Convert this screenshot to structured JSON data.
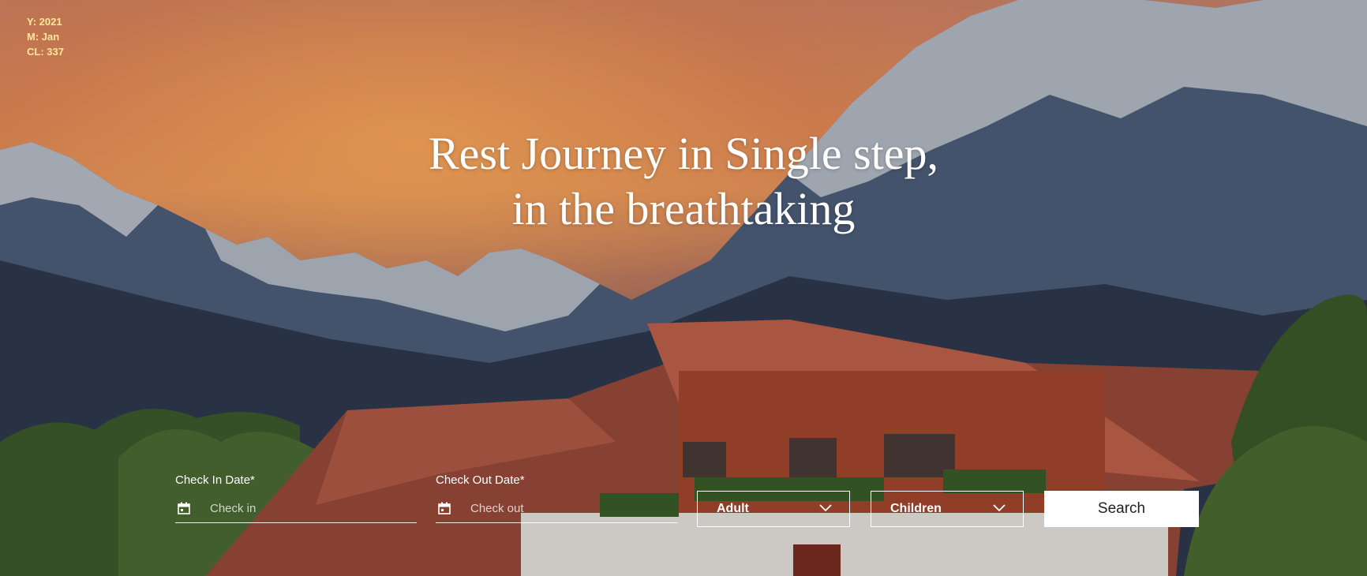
{
  "stats": {
    "year": "Y: 2021",
    "month": "M: Jan",
    "cl": "CL: 337"
  },
  "hero": {
    "headline_line1": "Rest Journey in Single step,",
    "headline_line2": "in the breathtaking"
  },
  "booking": {
    "check_in": {
      "label": "Check In Date*",
      "placeholder": "Check in",
      "icon": "calendar-icon"
    },
    "check_out": {
      "label": "Check Out Date*",
      "placeholder": "Check out",
      "icon": "calendar-icon"
    },
    "adult": {
      "value": "Adult",
      "icon": "chevron-down-icon"
    },
    "children": {
      "value": "Children",
      "icon": "chevron-down-icon"
    },
    "search_label": "Search"
  },
  "colors": {
    "stats_text": "#ffe89a",
    "button_bg": "#ffffff",
    "text_white": "#ffffff"
  }
}
